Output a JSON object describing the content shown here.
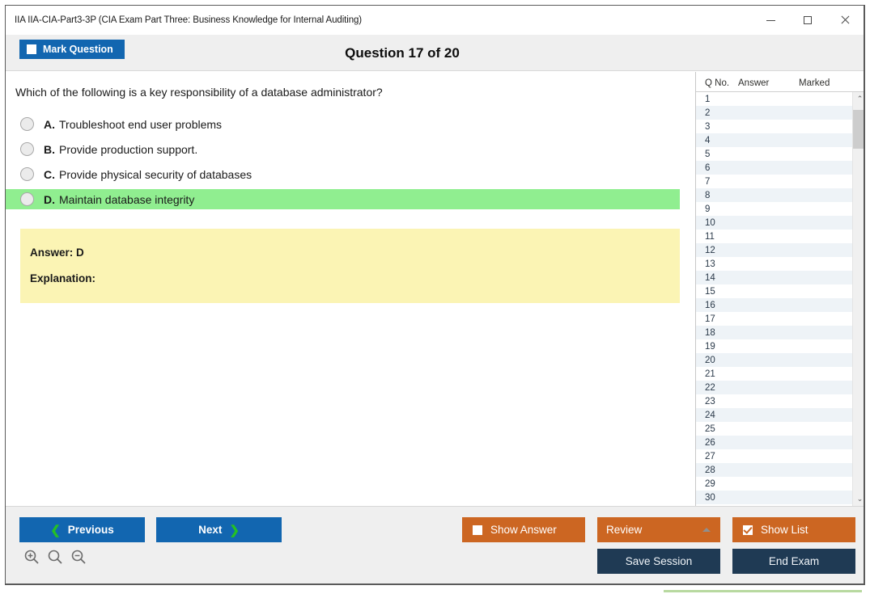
{
  "window": {
    "title": "IIA IIA-CIA-Part3-3P (CIA Exam Part Three: Business Knowledge for Internal Auditing)",
    "minimize_label": "─",
    "maximize_label": "□",
    "close_label": "✕"
  },
  "header": {
    "mark_question_label": "Mark Question",
    "mark_question_checked": false,
    "question_counter": "Question 17 of 20"
  },
  "question": {
    "text": "Which of the following is a key responsibility of a database administrator?",
    "options": [
      {
        "letter": "A.",
        "text": "Troubleshoot end user problems",
        "correct": false
      },
      {
        "letter": "B.",
        "text": "Provide production support.",
        "correct": false
      },
      {
        "letter": "C.",
        "text": "Provide physical security of databases",
        "correct": false
      },
      {
        "letter": "D.",
        "text": "Maintain database integrity",
        "correct": true
      }
    ]
  },
  "answer_box": {
    "answer_label": "Answer: D",
    "explanation_label": "Explanation:"
  },
  "question_list": {
    "columns": [
      "Q No.",
      "Answer",
      "Marked"
    ],
    "rows": [
      {
        "qno": "1",
        "answer": "",
        "marked": ""
      },
      {
        "qno": "2",
        "answer": "",
        "marked": ""
      },
      {
        "qno": "3",
        "answer": "",
        "marked": ""
      },
      {
        "qno": "4",
        "answer": "",
        "marked": ""
      },
      {
        "qno": "5",
        "answer": "",
        "marked": ""
      },
      {
        "qno": "6",
        "answer": "",
        "marked": ""
      },
      {
        "qno": "7",
        "answer": "",
        "marked": ""
      },
      {
        "qno": "8",
        "answer": "",
        "marked": ""
      },
      {
        "qno": "9",
        "answer": "",
        "marked": ""
      },
      {
        "qno": "10",
        "answer": "",
        "marked": ""
      },
      {
        "qno": "11",
        "answer": "",
        "marked": ""
      },
      {
        "qno": "12",
        "answer": "",
        "marked": ""
      },
      {
        "qno": "13",
        "answer": "",
        "marked": ""
      },
      {
        "qno": "14",
        "answer": "",
        "marked": ""
      },
      {
        "qno": "15",
        "answer": "",
        "marked": ""
      },
      {
        "qno": "16",
        "answer": "",
        "marked": ""
      },
      {
        "qno": "17",
        "answer": "",
        "marked": ""
      },
      {
        "qno": "18",
        "answer": "",
        "marked": ""
      },
      {
        "qno": "19",
        "answer": "",
        "marked": ""
      },
      {
        "qno": "20",
        "answer": "",
        "marked": ""
      },
      {
        "qno": "21",
        "answer": "",
        "marked": ""
      },
      {
        "qno": "22",
        "answer": "",
        "marked": ""
      },
      {
        "qno": "23",
        "answer": "",
        "marked": ""
      },
      {
        "qno": "24",
        "answer": "",
        "marked": ""
      },
      {
        "qno": "25",
        "answer": "",
        "marked": ""
      },
      {
        "qno": "26",
        "answer": "",
        "marked": ""
      },
      {
        "qno": "27",
        "answer": "",
        "marked": ""
      },
      {
        "qno": "28",
        "answer": "",
        "marked": ""
      },
      {
        "qno": "29",
        "answer": "",
        "marked": ""
      },
      {
        "qno": "30",
        "answer": "",
        "marked": ""
      }
    ],
    "scroll_up_glyph": "⌃",
    "scroll_down_glyph": "⌄"
  },
  "footer": {
    "previous_label": "Previous",
    "previous_chevron": "❮",
    "next_label": "Next",
    "next_chevron": "❯",
    "show_answer_label": "Show Answer",
    "show_answer_checked": false,
    "review_label": "Review",
    "show_list_label": "Show List",
    "show_list_checked": true,
    "save_session_label": "Save Session",
    "end_exam_label": "End Exam"
  },
  "colors": {
    "accent_blue": "#1266b0",
    "accent_orange": "#cc6622",
    "navy": "#1f3a54",
    "correct_green": "#90ee90",
    "answer_yellow": "#fbf4b4",
    "chevron_green": "#25c025"
  }
}
